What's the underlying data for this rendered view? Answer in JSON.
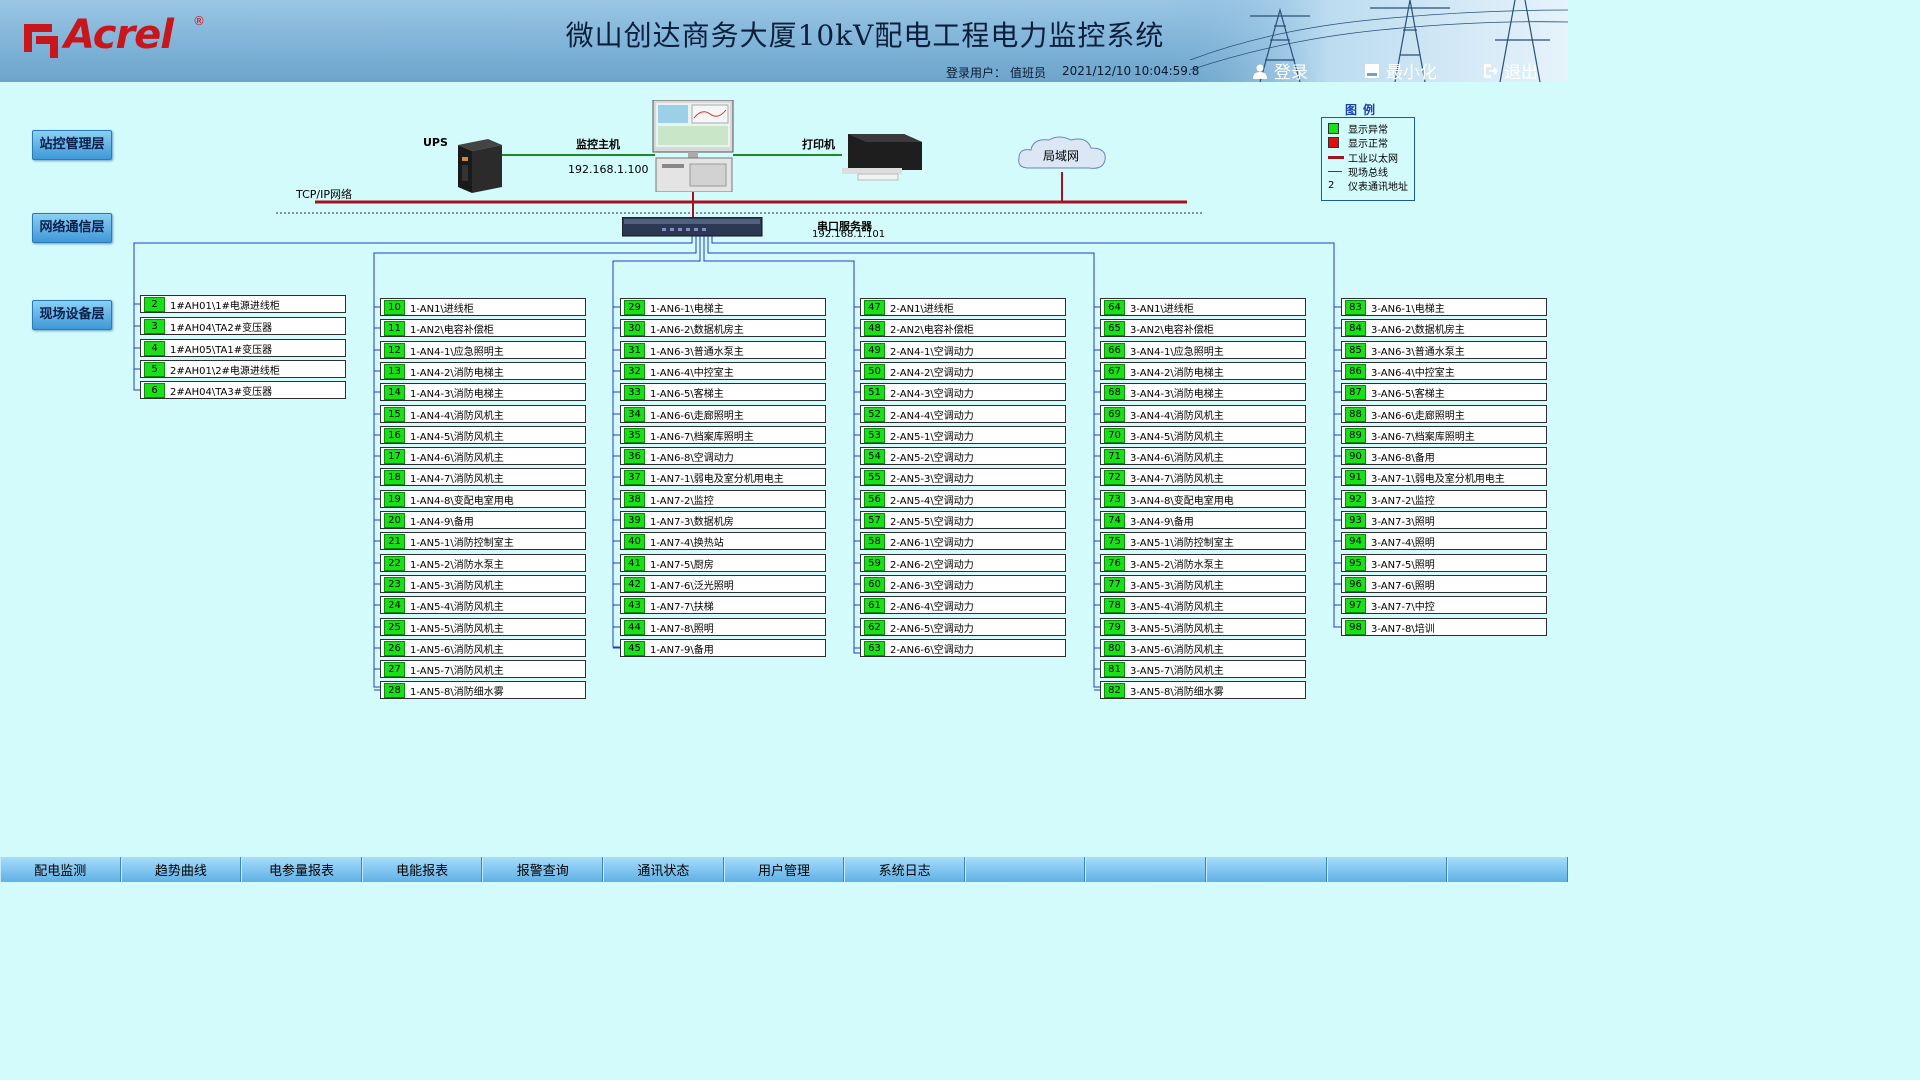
{
  "header": {
    "logo_text": "Acrel",
    "logo_reg": "®",
    "title": "微山创达商务大厦10kV配电工程电力监控系统",
    "user_label": "登录用户：",
    "user_name": "值班员",
    "date": "2021/12/10",
    "time": "10:04:59.8",
    "login": "登录",
    "minimize": "最小化",
    "exit": "退出"
  },
  "layers": [
    "站控管理层",
    "网络通信层",
    "现场设备层"
  ],
  "equipment": {
    "ups": "UPS",
    "host": "监控主机",
    "host_ip": "192.168.1.100",
    "printer": "打印机",
    "lan": "局域网",
    "tcpip": "TCP/IP网络",
    "serial_server": "串口服务器",
    "serial_ip": "192.168.1.101"
  },
  "legend": {
    "title": "图例",
    "items": [
      {
        "sym": "green-square",
        "label": "显示异常",
        "color": "#19e019"
      },
      {
        "sym": "red-square",
        "label": "显示正常",
        "color": "#e01010"
      },
      {
        "sym": "red-line",
        "label": "工业以太网",
        "color": "#a81020"
      },
      {
        "sym": "blue-line",
        "label": "现场总线",
        "color": "#1e3cc8"
      },
      {
        "sym": "text",
        "label": "仪表通讯地址",
        "value": "2"
      }
    ]
  },
  "columns": [
    [
      {
        "n": "2",
        "name": "1#AH01\\1#电源进线柜"
      },
      {
        "n": "3",
        "name": "1#AH04\\TA2#变压器"
      },
      {
        "n": "4",
        "name": "1#AH05\\TA1#变压器"
      },
      {
        "n": "5",
        "name": "2#AH01\\2#电源进线柜"
      },
      {
        "n": "6",
        "name": "2#AH04\\TA3#变压器"
      }
    ],
    [
      {
        "n": "10",
        "name": "1-AN1\\进线柜"
      },
      {
        "n": "11",
        "name": "1-AN2\\电容补偿柜"
      },
      {
        "n": "12",
        "name": "1-AN4-1\\应急照明主"
      },
      {
        "n": "13",
        "name": "1-AN4-2\\消防电梯主"
      },
      {
        "n": "14",
        "name": "1-AN4-3\\消防电梯主"
      },
      {
        "n": "15",
        "name": "1-AN4-4\\消防风机主"
      },
      {
        "n": "16",
        "name": "1-AN4-5\\消防风机主"
      },
      {
        "n": "17",
        "name": "1-AN4-6\\消防风机主"
      },
      {
        "n": "18",
        "name": "1-AN4-7\\消防风机主"
      },
      {
        "n": "19",
        "name": "1-AN4-8\\变配电室用电"
      },
      {
        "n": "20",
        "name": "1-AN4-9\\备用"
      },
      {
        "n": "21",
        "name": "1-AN5-1\\消防控制室主"
      },
      {
        "n": "22",
        "name": "1-AN5-2\\消防水泵主"
      },
      {
        "n": "23",
        "name": "1-AN5-3\\消防风机主"
      },
      {
        "n": "24",
        "name": "1-AN5-4\\消防风机主"
      },
      {
        "n": "25",
        "name": "1-AN5-5\\消防风机主"
      },
      {
        "n": "26",
        "name": "1-AN5-6\\消防风机主"
      },
      {
        "n": "27",
        "name": "1-AN5-7\\消防风机主"
      },
      {
        "n": "28",
        "name": "1-AN5-8\\消防细水雾"
      }
    ],
    [
      {
        "n": "29",
        "name": "1-AN6-1\\电梯主"
      },
      {
        "n": "30",
        "name": "1-AN6-2\\数据机房主"
      },
      {
        "n": "31",
        "name": "1-AN6-3\\普通水泵主"
      },
      {
        "n": "32",
        "name": "1-AN6-4\\中控室主"
      },
      {
        "n": "33",
        "name": "1-AN6-5\\客梯主"
      },
      {
        "n": "34",
        "name": "1-AN6-6\\走廊照明主"
      },
      {
        "n": "35",
        "name": "1-AN6-7\\档案库照明主"
      },
      {
        "n": "36",
        "name": "1-AN6-8\\空调动力"
      },
      {
        "n": "37",
        "name": "1-AN7-1\\弱电及室分机用电主"
      },
      {
        "n": "38",
        "name": "1-AN7-2\\监控"
      },
      {
        "n": "39",
        "name": "1-AN7-3\\数据机房"
      },
      {
        "n": "40",
        "name": "1-AN7-4\\换热站"
      },
      {
        "n": "41",
        "name": "1-AN7-5\\厨房"
      },
      {
        "n": "42",
        "name": "1-AN7-6\\泛光照明"
      },
      {
        "n": "43",
        "name": "1-AN7-7\\扶梯"
      },
      {
        "n": "44",
        "name": "1-AN7-8\\照明"
      },
      {
        "n": "45",
        "name": "1-AN7-9\\备用"
      }
    ],
    [
      {
        "n": "47",
        "name": "2-AN1\\进线柜"
      },
      {
        "n": "48",
        "name": "2-AN2\\电容补偿柜"
      },
      {
        "n": "49",
        "name": "2-AN4-1\\空调动力"
      },
      {
        "n": "50",
        "name": "2-AN4-2\\空调动力"
      },
      {
        "n": "51",
        "name": "2-AN4-3\\空调动力"
      },
      {
        "n": "52",
        "name": "2-AN4-4\\空调动力"
      },
      {
        "n": "53",
        "name": "2-AN5-1\\空调动力"
      },
      {
        "n": "54",
        "name": "2-AN5-2\\空调动力"
      },
      {
        "n": "55",
        "name": "2-AN5-3\\空调动力"
      },
      {
        "n": "56",
        "name": "2-AN5-4\\空调动力"
      },
      {
        "n": "57",
        "name": "2-AN5-5\\空调动力"
      },
      {
        "n": "58",
        "name": "2-AN6-1\\空调动力"
      },
      {
        "n": "59",
        "name": "2-AN6-2\\空调动力"
      },
      {
        "n": "60",
        "name": "2-AN6-3\\空调动力"
      },
      {
        "n": "61",
        "name": "2-AN6-4\\空调动力"
      },
      {
        "n": "62",
        "name": "2-AN6-5\\空调动力"
      },
      {
        "n": "63",
        "name": "2-AN6-6\\空调动力"
      }
    ],
    [
      {
        "n": "64",
        "name": "3-AN1\\进线柜"
      },
      {
        "n": "65",
        "name": "3-AN2\\电容补偿柜"
      },
      {
        "n": "66",
        "name": "3-AN4-1\\应急照明主"
      },
      {
        "n": "67",
        "name": "3-AN4-2\\消防电梯主"
      },
      {
        "n": "68",
        "name": "3-AN4-3\\消防电梯主"
      },
      {
        "n": "69",
        "name": "3-AN4-4\\消防风机主"
      },
      {
        "n": "70",
        "name": "3-AN4-5\\消防风机主"
      },
      {
        "n": "71",
        "name": "3-AN4-6\\消防风机主"
      },
      {
        "n": "72",
        "name": "3-AN4-7\\消防风机主"
      },
      {
        "n": "73",
        "name": "3-AN4-8\\变配电室用电"
      },
      {
        "n": "74",
        "name": "3-AN4-9\\备用"
      },
      {
        "n": "75",
        "name": "3-AN5-1\\消防控制室主"
      },
      {
        "n": "76",
        "name": "3-AN5-2\\消防水泵主"
      },
      {
        "n": "77",
        "name": "3-AN5-3\\消防风机主"
      },
      {
        "n": "78",
        "name": "3-AN5-4\\消防风机主"
      },
      {
        "n": "79",
        "name": "3-AN5-5\\消防风机主"
      },
      {
        "n": "80",
        "name": "3-AN5-6\\消防风机主"
      },
      {
        "n": "81",
        "name": "3-AN5-7\\消防风机主"
      },
      {
        "n": "82",
        "name": "3-AN5-8\\消防细水雾"
      }
    ],
    [
      {
        "n": "83",
        "name": "3-AN6-1\\电梯主"
      },
      {
        "n": "84",
        "name": "3-AN6-2\\数据机房主"
      },
      {
        "n": "85",
        "name": "3-AN6-3\\普通水泵主"
      },
      {
        "n": "86",
        "name": "3-AN6-4\\中控室主"
      },
      {
        "n": "87",
        "name": "3-AN6-5\\客梯主"
      },
      {
        "n": "88",
        "name": "3-AN6-6\\走廊照明主"
      },
      {
        "n": "89",
        "name": "3-AN6-7\\档案库照明主"
      },
      {
        "n": "90",
        "name": "3-AN6-8\\备用"
      },
      {
        "n": "91",
        "name": "3-AN7-1\\弱电及室分机用电主"
      },
      {
        "n": "92",
        "name": "3-AN7-2\\监控"
      },
      {
        "n": "93",
        "name": "3-AN7-3\\照明"
      },
      {
        "n": "94",
        "name": "3-AN7-4\\照明"
      },
      {
        "n": "95",
        "name": "3-AN7-5\\照明"
      },
      {
        "n": "96",
        "name": "3-AN7-6\\照明"
      },
      {
        "n": "97",
        "name": "3-AN7-7\\中控"
      },
      {
        "n": "98",
        "name": "3-AN7-8\\培训"
      }
    ]
  ],
  "nav": [
    "配电监测",
    "趋势曲线",
    "电参量报表",
    "电能报表",
    "报警查询",
    "通讯状态",
    "用户管理",
    "系统日志",
    "",
    "",
    "",
    "",
    ""
  ],
  "colors": {
    "ethernet": "#a81020",
    "fieldbus": "#1e3cc8",
    "status_green": "#19e019",
    "link_green": "#1a8a2a"
  }
}
